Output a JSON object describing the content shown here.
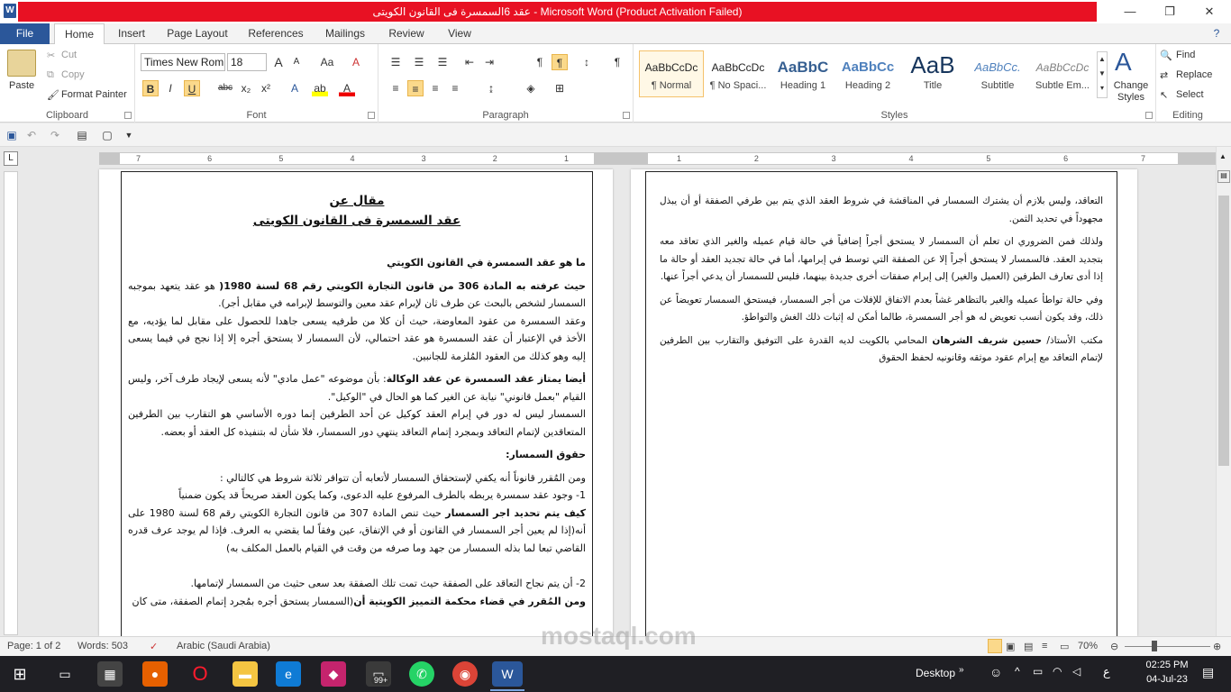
{
  "window": {
    "title": "عقد 6السمسرة فى القانون الكويتى  -  Microsoft Word (Product Activation Failed)",
    "app_icon": "W",
    "min": "—",
    "max": "❐",
    "close": "✕",
    "help": "?"
  },
  "tabs": [
    {
      "label": "File"
    },
    {
      "label": "Home"
    },
    {
      "label": "Insert"
    },
    {
      "label": "Page Layout"
    },
    {
      "label": "References"
    },
    {
      "label": "Mailings"
    },
    {
      "label": "Review"
    },
    {
      "label": "View"
    }
  ],
  "ribbon": {
    "clipboard": {
      "paste": "Paste",
      "cut": "Cut",
      "copy": "Copy",
      "format_painter": "Format Painter",
      "label": "Clipboard"
    },
    "font": {
      "name": "Times New Rom",
      "size": "18",
      "label": "Font",
      "bold": "B",
      "italic": "I",
      "underline": "U",
      "strike": "abc",
      "sub": "x₂",
      "sup": "x²",
      "grow": "A",
      "shrink": "A",
      "case": "Aa",
      "clear": "A"
    },
    "paragraph": {
      "label": "Paragraph",
      "pilcrow": "¶"
    },
    "styles": {
      "label": "Styles",
      "items": [
        {
          "preview": "AaBbCcDc",
          "name": "¶ Normal"
        },
        {
          "preview": "AaBbCcDc",
          "name": "¶ No Spaci..."
        },
        {
          "preview": "AaBbC",
          "name": "Heading 1"
        },
        {
          "preview": "AaBbCc",
          "name": "Heading 2"
        },
        {
          "preview": "AaB",
          "name": "Title"
        },
        {
          "preview": "AaBbCc.",
          "name": "Subtitle"
        },
        {
          "preview": "AaBbCcDc",
          "name": "Subtle Em..."
        }
      ],
      "change": "Change Styles"
    },
    "editing": {
      "label": "Editing",
      "find": "Find",
      "replace": "Replace",
      "select": "Select"
    }
  },
  "ruler": {
    "labels": [
      "7",
      "6",
      "5",
      "4",
      "3",
      "2",
      "1",
      "1",
      "2",
      "3",
      "4",
      "5",
      "6",
      "7"
    ]
  },
  "left_page": {
    "title1": "مقال عن",
    "title2": "عقد السمسرة فى القانون الكويتى",
    "q1": "ما هو عقد السمسرة في القانون الكويتي",
    "p1_bold": "حيث عرفته به المادة 306 من قانون التجارة الكويتي رقم 68 لسنة 1980(",
    "p1_rest": " هو عقد يتعهد بموجبه السمسار لشخص بالبحث عن طرف ثان لإبرام عقد معين والتوسط لإبرامه في مقابل أجر).",
    "p2": "وعقد السمسرة من عقود المعاوضة، حيث أن كلا من طرفيه يسعى جاهدا للحصول على مقابل لما يؤديه، مع الأخذ في الإعتبار أن عقد السمسرة هو عقد احتمالي، لأن السمسار لا يستحق أجره إلا إذا نجح في فيما يسعى إليه وهو كذلك من العقود المُلزمة للجانبين.",
    "p3_bold": "أيضا يمتاز عقد السمسرة عن عقد الوكالة",
    "p3_rest": ": بأن موضوعه \"عمل مادي\" لأنه يسعى لإيجاد طرف آخر، وليس القيام \"بعمل قانوني\" نيابة عن الغير كما هو الحال في \"الوكيل\".",
    "p4": "السمسار ليس له دور في إبرام العقد كوكيل عن أحد الطرفين إنما دوره الأساسي هو التقارب بين الطرفين المتعاقدين لإتمام التعاقد وبمجرد إتمام التعاقد ينتهي دور السمسار، فلا شأن له بتنفيذه كل العقد أو بعضه.",
    "h2": "حقوق السمسار:",
    "p5": "ومن المُقرر قانوناً أنه يكفي لإستحقاق السمسار لأتعابه أن تتوافر ثلاثة شروط هي كالتالي :",
    "p6": "1- وجود عقد سمسرة يربطه بالطرف المرفوع عليه الدعوى، وكما يكون العقد صريحاً قد يكون ضمنياً",
    "p7_bold": "كيف يتم تحديد اجر السمسار",
    "p7_rest": " حيث  تنص المادة 307 من قانون التجارة الكويتي رقم 68 لسنة 1980 على أنه(إذا لم يعين أجر السمسار في القانون أو في الإتفاق، عين وفقاً لما يقضي به العرف. فإذا لم يوجد عرف قدره القاضي تبعا لما بذله السمسار من جهد وما صرفه من وقت في القيام بالعمل المكلف به)",
    "p8": "2- أن يتم نجاح التعاقد على الصفقة حيث تمت تلك الصفقة بعد سعى حثيث من السمسار لإتمامها.",
    "p9_bold": "ومن المُقرر في قضاء محكمة التمييز الكويتية أن",
    "p9_rest": "(السمسار يستحق أجره بمُجرد إتمام الصفقة، متى كان"
  },
  "right_page": {
    "p1": "التعاقد، وليس بلازم أن يشترك السمسار في المناقشة في شروط العقد الذي يتم بين طرفي الصفقة أو أن يبذل مجهوداً في تحديد الثمن.",
    "p2": "ولذلك فمن الضروري ان تعلم أن السمسار لا يستحق أجراً إضافياً في حالة قيام عميله والغير الذي تعاقد معه بتجديد العقد. فالسمسار لا يستحق أجراً إلا عن الصفقة التي توسط في إبرامها، أما في حالة تجديد العقد أو حالة ما إذا أدى تعارف الطرفين (العميل والغير) إلى إبرام صفقات أخرى جديدة بينهما، فليس للسمسار أن يدعي أجراً عنها.",
    "p3": "وفي حالة تواطأ عميله والغير بالتظاهر غشاً بعدم الاتفاق للإفلات من أجر السمسار، فيستحق السمسار تعويضاً عن ذلك، وقد يكون أنسب تعويض له هو أجر السمسرة، طالما أمكن له إثبات ذلك الغش والتواطؤ.",
    "p4_pre": "مكتب الأستاذ/ ",
    "p4_bold": "حسين شريف الشرهان",
    "p4_rest": " المحامي بالكويت لديه القدرة على التوفيق والتقارب بين الطرفين لإتمام التعاقد مع إبرام عقود موثقه وقانونيه لحفظ الحقوق"
  },
  "status": {
    "page": "Page: 1 of 2",
    "words": "Words: 503",
    "language": "Arabic (Saudi Arabia)",
    "zoom": "70%"
  },
  "taskbar": {
    "desktop": "Desktop",
    "time": "02:25 PM",
    "date": "04-Jul-23",
    "badge": "99+",
    "lang": "ع"
  },
  "watermark": "mostaql.com"
}
